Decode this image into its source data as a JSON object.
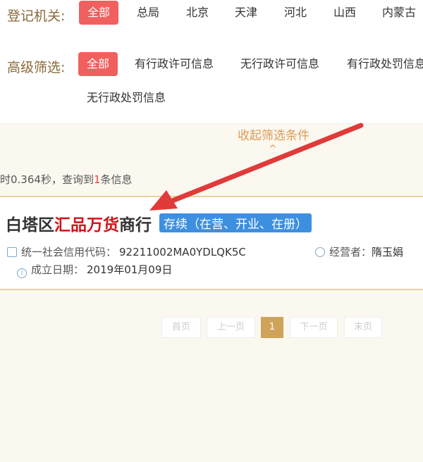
{
  "filters": {
    "authority": {
      "label": "登记机关:",
      "options": [
        "全部",
        "总局",
        "北京",
        "天津",
        "河北",
        "山西",
        "内蒙古"
      ]
    },
    "advanced": {
      "label": "高级筛选:",
      "options": [
        "全部",
        "有行政许可信息",
        "无行政许可信息",
        "有行政处罚信息",
        "无行政处罚信息"
      ]
    }
  },
  "collapse": {
    "label": "收起筛选条件",
    "caret": "^"
  },
  "result": {
    "prefix": "时0.364秒，查询到",
    "count": "1",
    "suffix": "条信息"
  },
  "company": {
    "name_pre": "白塔区",
    "name_hl": "汇品万货",
    "name_post": "商行",
    "status": "存续（在营、开业、在册）",
    "credit_label": "统一社会信用代码：",
    "credit_code": "92211002MA0YDLQK5C",
    "operator_label": "经营者：",
    "operator": "隋玉娟",
    "date_label": "成立日期：",
    "date": "2019年01月09日"
  },
  "pagination": {
    "first": "首页",
    "prev": "上一页",
    "current": "1",
    "next": "下一页",
    "last": "末页"
  },
  "colors": {
    "accent": "#f0605e",
    "annotation_arrow": "#e03a3a",
    "status": "#3d8fe0",
    "page_active": "#cfa35a"
  }
}
